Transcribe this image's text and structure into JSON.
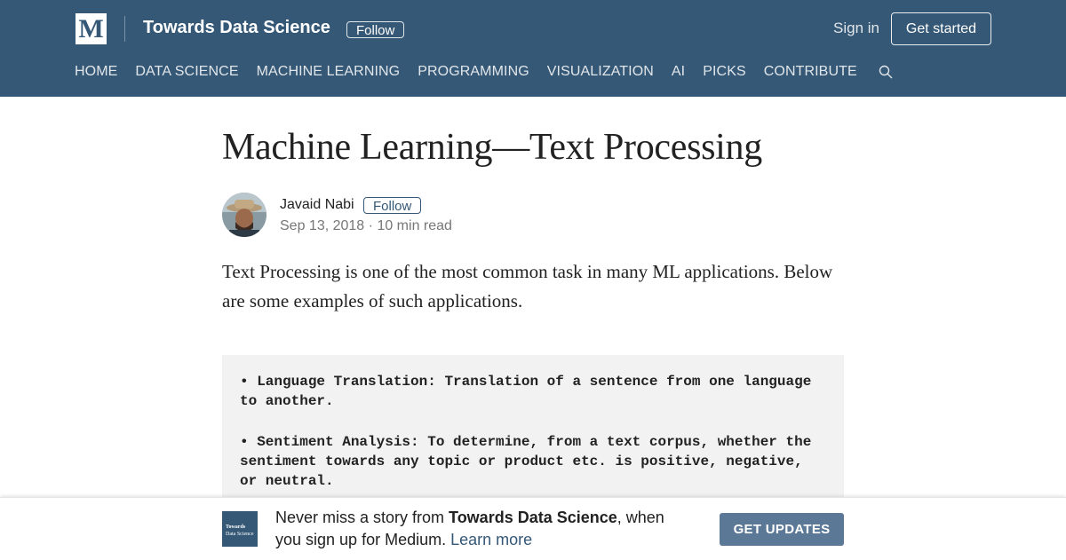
{
  "header": {
    "logo_letter": "M",
    "publication": "Towards Data Science",
    "follow_label": "Follow",
    "signin_label": "Sign in",
    "get_started_label": "Get started",
    "nav": [
      "HOME",
      "DATA SCIENCE",
      "MACHINE LEARNING",
      "PROGRAMMING",
      "VISUALIZATION",
      "AI",
      "PICKS",
      "CONTRIBUTE"
    ],
    "search_icon": "search-icon",
    "bg_color": "#355876"
  },
  "article": {
    "title": "Machine Learning—Text Processing",
    "author": "Javaid Nabi",
    "follow_label": "Follow",
    "date": "Sep 13, 2018",
    "separator": "·",
    "read_time": "10 min read",
    "intro": "Text Processing is one of the most common task in many ML applications. Below are some examples of such applications.",
    "code_items": [
      "• Language Translation: Translation of a sentence from one language to another.",
      "• Sentiment Analysis: To determine, from a text corpus, whether the sentiment towards any topic or product etc. is positive, negative, or neutral."
    ]
  },
  "banner": {
    "logo_line1": "Towards",
    "logo_line2": "Data Science",
    "text_before": "Never miss a story from ",
    "publication": "Towards Data Science",
    "text_after": ", when you sign up for Medium. ",
    "learn_more": "Learn more",
    "button_label": "GET UPDATES",
    "button_color": "#5b7896"
  }
}
